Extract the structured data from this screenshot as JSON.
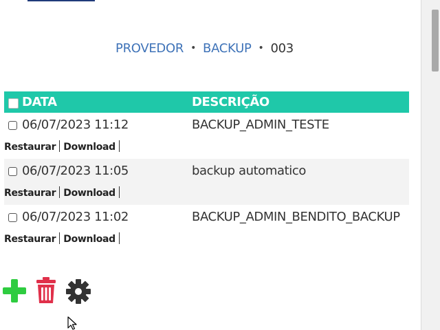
{
  "breadcrumb": {
    "items": [
      "PROVEDOR",
      "BACKUP"
    ],
    "separator": "•",
    "current": "003"
  },
  "table": {
    "header_color": "#1fc8a9",
    "columns": {
      "data": "DATA",
      "descricao": "DESCRIÇÃO"
    },
    "rows": [
      {
        "date": "06/07/2023 11:12",
        "description": "BACKUP_ADMIN_TESTE"
      },
      {
        "date": "06/07/2023 11:05",
        "description": "backup automatico"
      },
      {
        "date": "06/07/2023 11:02",
        "description": "BACKUP_ADMIN_BENDITO_BACKUP"
      }
    ],
    "actions": {
      "restore": "Restaurar",
      "download": "Download"
    }
  },
  "toolbar": {
    "add_icon": "plus-icon",
    "add_color": "#2ecc40",
    "delete_icon": "trash-icon",
    "delete_color": "#e0304a",
    "settings_icon": "gear-icon",
    "settings_color": "#333333"
  }
}
